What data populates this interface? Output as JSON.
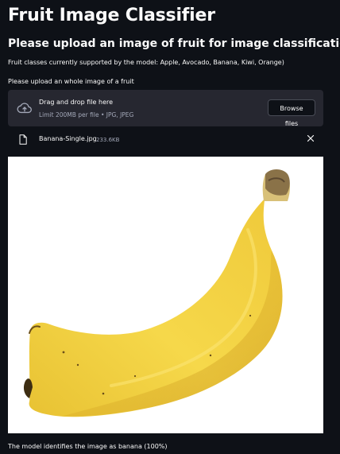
{
  "app": {
    "title": "Fruit Image Classifier",
    "subtitle": "Please upload an image of fruit for image classification",
    "classes_text": "Fruit classes currently supported by the model: Apple, Avocado, Banana, Kiwi, Orange)"
  },
  "uploader": {
    "label": "Please upload an whole image of a fruit",
    "drag_text": "Drag and drop file here",
    "limit_text": "Limit 200MB per file • JPG, JPEG",
    "browse_label": "Browse files",
    "upload_icon": "cloud-upload-icon"
  },
  "uploaded_file": {
    "name": "Banana-Single.jpg",
    "size": "233.6KB",
    "file_icon": "file-icon",
    "remove_icon": "close-icon"
  },
  "result": {
    "text": "The model identifies the image as banana (100%)"
  },
  "colors": {
    "background": "#0e1117",
    "panel": "#262730",
    "text": "#fafafa",
    "muted_text": "#a3a8b8",
    "banana_yellow": "#f4d23f",
    "image_background": "#ffffff"
  }
}
